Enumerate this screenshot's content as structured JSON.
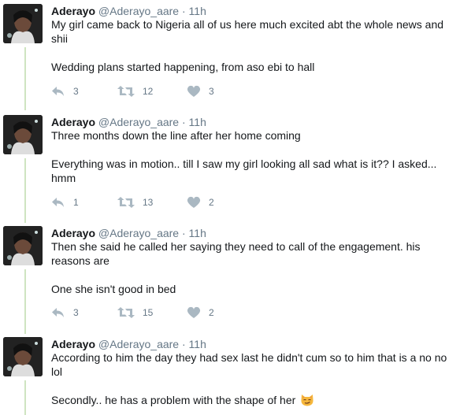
{
  "tweets": [
    {
      "name": "Aderayo",
      "handle": "@Aderayo_aare",
      "dot": "·",
      "time": "11h",
      "line1": "My girl came back to Nigeria all of us here much excited abt the whole news and shii",
      "line2": "Wedding plans started happening, from aso ebi to hall",
      "replies": "3",
      "retweets": "12",
      "likes": "3"
    },
    {
      "name": "Aderayo",
      "handle": "@Aderayo_aare",
      "dot": "·",
      "time": "11h",
      "line1": "Three months down the line after her home coming",
      "line2": "Everything was in motion.. till I saw my girl looking all sad what is it?? I asked... hmm",
      "replies": "1",
      "retweets": "13",
      "likes": "2"
    },
    {
      "name": "Aderayo",
      "handle": "@Aderayo_aare",
      "dot": "·",
      "time": "11h",
      "line1": "Then she said he called her saying they need to call  of the engagement. his reasons are",
      "line2": "One she isn't good in bed",
      "replies": "3",
      "retweets": "15",
      "likes": "2"
    },
    {
      "name": "Aderayo",
      "handle": "@Aderayo_aare",
      "dot": "·",
      "time": "11h",
      "line1": "According to him the day they had sex last he didn't cum so to him that is a no no lol",
      "line2": "Secondly.. he has a problem with the shape of her",
      "emoji": "smirking-cat-emoji"
    }
  ],
  "icons": {
    "reply": "reply-icon",
    "retweet": "retweet-icon",
    "like": "heart-icon"
  },
  "colors": {
    "thread_line": "#cfe4c1",
    "icon_gray": "#aab8c2",
    "meta_gray": "#657786",
    "text": "#14171a"
  }
}
